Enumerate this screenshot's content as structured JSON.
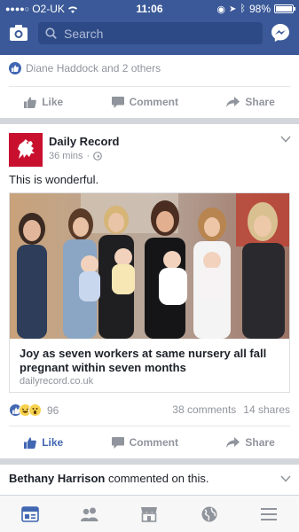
{
  "status_bar": {
    "carrier": "O2-UK",
    "time": "11:06",
    "battery": "98%"
  },
  "header": {
    "search_placeholder": "Search"
  },
  "previous_post": {
    "likes_text": "Diane Haddock and 2 others",
    "actions": {
      "like": "Like",
      "comment": "Comment",
      "share": "Share"
    }
  },
  "post": {
    "page_name": "Daily Record",
    "time": "36 mins",
    "text": "This is wonderful.",
    "link": {
      "title": "Joy as seven workers at same nursery all fall pregnant within seven months",
      "domain": "dailyrecord.co.uk"
    },
    "reactions_count": "96",
    "comments": "38 comments",
    "shares": "14 shares",
    "actions": {
      "like": "Like",
      "comment": "Comment",
      "share": "Share"
    }
  },
  "next_story": {
    "name": "Bethany Harrison",
    "action": "commented on this."
  },
  "colors": {
    "brand": "#3b5998",
    "like_active": "#4267b2"
  },
  "tabbar": {
    "tabs": [
      "news-feed-icon",
      "friends-icon",
      "marketplace-icon",
      "notifications-globe-icon",
      "menu-icon"
    ]
  }
}
